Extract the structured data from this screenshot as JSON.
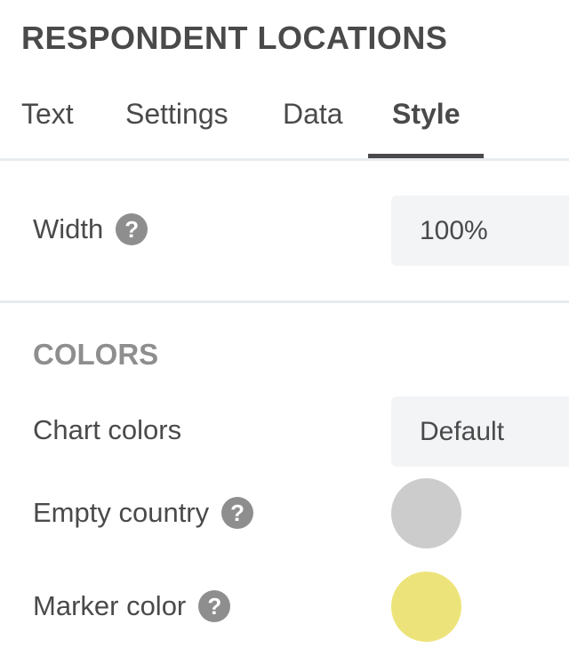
{
  "panel": {
    "title": "RESPONDENT LOCATIONS"
  },
  "tabs": [
    {
      "label": "Text",
      "active": false
    },
    {
      "label": "Settings",
      "active": false
    },
    {
      "label": "Data",
      "active": false
    },
    {
      "label": "Style",
      "active": true
    }
  ],
  "width_setting": {
    "label": "Width",
    "help_icon": "question-circle-icon",
    "help_glyph": "?",
    "value": "100%"
  },
  "colors_section": {
    "heading": "COLORS",
    "chart_colors": {
      "label": "Chart colors",
      "selected": "Default"
    },
    "empty_country": {
      "label": "Empty country",
      "help_icon": "question-circle-icon",
      "help_glyph": "?",
      "color": "#cccccc"
    },
    "marker_color": {
      "label": "Marker color",
      "help_icon": "question-circle-icon",
      "help_glyph": "?",
      "color": "#ece47a"
    }
  }
}
